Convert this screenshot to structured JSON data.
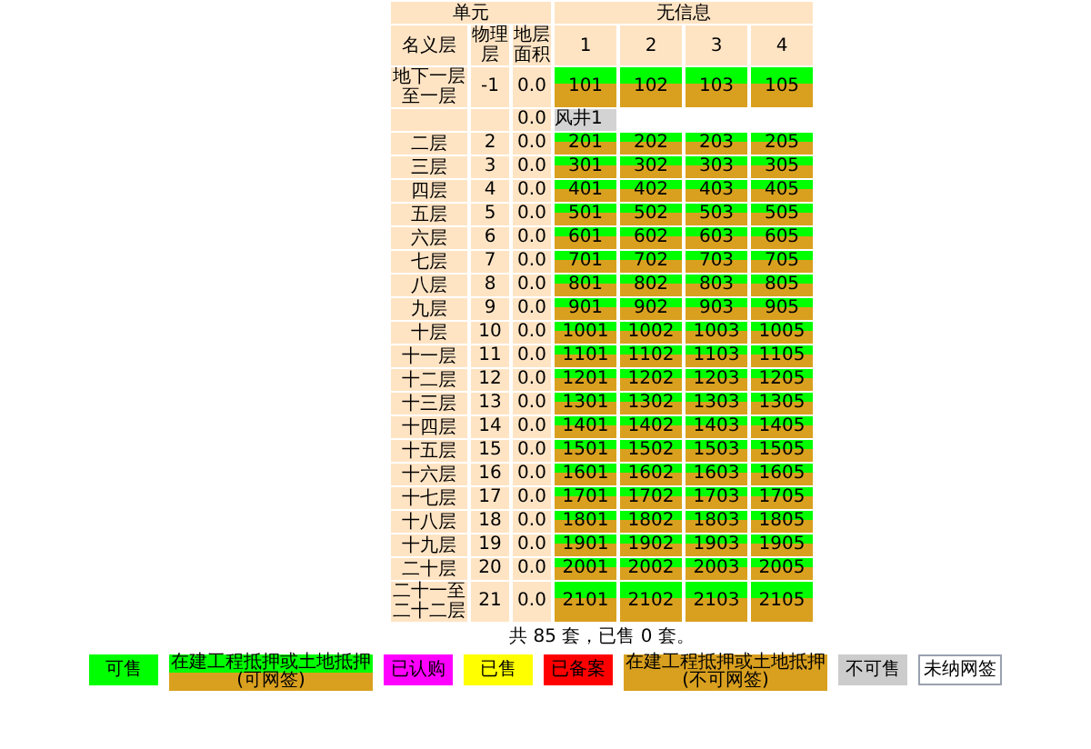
{
  "header": {
    "unit_label": "单元",
    "info": "无信息",
    "col_name": "名义层",
    "col_physical": "物理层",
    "col_area": "地层面积",
    "unit_numbers": [
      "1",
      "2",
      "3",
      "4"
    ]
  },
  "floors": [
    {
      "name": "地下一层至一层",
      "physical": "-1",
      "area": "0.0",
      "units": [
        {
          "label": "101",
          "kind": "mortgage_signable"
        },
        {
          "label": "102",
          "kind": "mortgage_signable"
        },
        {
          "label": "103",
          "kind": "mortgage_signable"
        },
        {
          "label": "105",
          "kind": "mortgage_signable"
        }
      ]
    },
    {
      "area": "0.0",
      "units": [
        {
          "label": "风井1",
          "kind": "shaft"
        }
      ]
    },
    {
      "name": "二层",
      "physical": "2",
      "area": "0.0",
      "units": [
        {
          "label": "201",
          "kind": "mortgage_signable"
        },
        {
          "label": "202",
          "kind": "mortgage_signable"
        },
        {
          "label": "203",
          "kind": "mortgage_signable"
        },
        {
          "label": "205",
          "kind": "mortgage_signable"
        }
      ]
    },
    {
      "name": "三层",
      "physical": "3",
      "area": "0.0",
      "units": [
        {
          "label": "301",
          "kind": "mortgage_signable"
        },
        {
          "label": "302",
          "kind": "mortgage_signable"
        },
        {
          "label": "303",
          "kind": "mortgage_signable"
        },
        {
          "label": "305",
          "kind": "mortgage_signable"
        }
      ]
    },
    {
      "name": "四层",
      "physical": "4",
      "area": "0.0",
      "units": [
        {
          "label": "401",
          "kind": "mortgage_signable"
        },
        {
          "label": "402",
          "kind": "mortgage_signable"
        },
        {
          "label": "403",
          "kind": "mortgage_signable"
        },
        {
          "label": "405",
          "kind": "mortgage_signable"
        }
      ]
    },
    {
      "name": "五层",
      "physical": "5",
      "area": "0.0",
      "units": [
        {
          "label": "501",
          "kind": "mortgage_signable"
        },
        {
          "label": "502",
          "kind": "mortgage_signable"
        },
        {
          "label": "503",
          "kind": "mortgage_signable"
        },
        {
          "label": "505",
          "kind": "mortgage_signable"
        }
      ]
    },
    {
      "name": "六层",
      "physical": "6",
      "area": "0.0",
      "units": [
        {
          "label": "601",
          "kind": "mortgage_signable"
        },
        {
          "label": "602",
          "kind": "mortgage_signable"
        },
        {
          "label": "603",
          "kind": "mortgage_signable"
        },
        {
          "label": "605",
          "kind": "mortgage_signable"
        }
      ]
    },
    {
      "name": "七层",
      "physical": "7",
      "area": "0.0",
      "units": [
        {
          "label": "701",
          "kind": "mortgage_signable"
        },
        {
          "label": "702",
          "kind": "mortgage_signable"
        },
        {
          "label": "703",
          "kind": "mortgage_signable"
        },
        {
          "label": "705",
          "kind": "mortgage_signable"
        }
      ]
    },
    {
      "name": "八层",
      "physical": "8",
      "area": "0.0",
      "units": [
        {
          "label": "801",
          "kind": "mortgage_signable"
        },
        {
          "label": "802",
          "kind": "mortgage_signable"
        },
        {
          "label": "803",
          "kind": "mortgage_signable"
        },
        {
          "label": "805",
          "kind": "mortgage_signable"
        }
      ]
    },
    {
      "name": "九层",
      "physical": "9",
      "area": "0.0",
      "units": [
        {
          "label": "901",
          "kind": "mortgage_signable"
        },
        {
          "label": "902",
          "kind": "mortgage_signable"
        },
        {
          "label": "903",
          "kind": "mortgage_signable"
        },
        {
          "label": "905",
          "kind": "mortgage_signable"
        }
      ]
    },
    {
      "name": "十层",
      "physical": "10",
      "area": "0.0",
      "units": [
        {
          "label": "1001",
          "kind": "mortgage_signable"
        },
        {
          "label": "1002",
          "kind": "mortgage_signable"
        },
        {
          "label": "1003",
          "kind": "mortgage_signable"
        },
        {
          "label": "1005",
          "kind": "mortgage_signable"
        }
      ]
    },
    {
      "name": "十一层",
      "physical": "11",
      "area": "0.0",
      "units": [
        {
          "label": "1101",
          "kind": "mortgage_signable"
        },
        {
          "label": "1102",
          "kind": "mortgage_signable"
        },
        {
          "label": "1103",
          "kind": "mortgage_signable"
        },
        {
          "label": "1105",
          "kind": "mortgage_signable"
        }
      ]
    },
    {
      "name": "十二层",
      "physical": "12",
      "area": "0.0",
      "units": [
        {
          "label": "1201",
          "kind": "mortgage_signable"
        },
        {
          "label": "1202",
          "kind": "mortgage_signable"
        },
        {
          "label": "1203",
          "kind": "mortgage_signable"
        },
        {
          "label": "1205",
          "kind": "mortgage_signable"
        }
      ]
    },
    {
      "name": "十三层",
      "physical": "13",
      "area": "0.0",
      "units": [
        {
          "label": "1301",
          "kind": "mortgage_signable"
        },
        {
          "label": "1302",
          "kind": "mortgage_signable"
        },
        {
          "label": "1303",
          "kind": "mortgage_signable"
        },
        {
          "label": "1305",
          "kind": "mortgage_signable"
        }
      ]
    },
    {
      "name": "十四层",
      "physical": "14",
      "area": "0.0",
      "units": [
        {
          "label": "1401",
          "kind": "mortgage_signable"
        },
        {
          "label": "1402",
          "kind": "mortgage_signable"
        },
        {
          "label": "1403",
          "kind": "mortgage_signable"
        },
        {
          "label": "1405",
          "kind": "mortgage_signable"
        }
      ]
    },
    {
      "name": "十五层",
      "physical": "15",
      "area": "0.0",
      "units": [
        {
          "label": "1501",
          "kind": "mortgage_signable"
        },
        {
          "label": "1502",
          "kind": "mortgage_signable"
        },
        {
          "label": "1503",
          "kind": "mortgage_signable"
        },
        {
          "label": "1505",
          "kind": "mortgage_signable"
        }
      ]
    },
    {
      "name": "十六层",
      "physical": "16",
      "area": "0.0",
      "units": [
        {
          "label": "1601",
          "kind": "mortgage_signable"
        },
        {
          "label": "1602",
          "kind": "mortgage_signable"
        },
        {
          "label": "1603",
          "kind": "mortgage_signable"
        },
        {
          "label": "1605",
          "kind": "mortgage_signable"
        }
      ]
    },
    {
      "name": "十七层",
      "physical": "17",
      "area": "0.0",
      "units": [
        {
          "label": "1701",
          "kind": "mortgage_signable"
        },
        {
          "label": "1702",
          "kind": "mortgage_signable"
        },
        {
          "label": "1703",
          "kind": "mortgage_signable"
        },
        {
          "label": "1705",
          "kind": "mortgage_signable"
        }
      ]
    },
    {
      "name": "十八层",
      "physical": "18",
      "area": "0.0",
      "units": [
        {
          "label": "1801",
          "kind": "mortgage_signable"
        },
        {
          "label": "1802",
          "kind": "mortgage_signable"
        },
        {
          "label": "1803",
          "kind": "mortgage_signable"
        },
        {
          "label": "1805",
          "kind": "mortgage_signable"
        }
      ]
    },
    {
      "name": "十九层",
      "physical": "19",
      "area": "0.0",
      "units": [
        {
          "label": "1901",
          "kind": "mortgage_signable"
        },
        {
          "label": "1902",
          "kind": "mortgage_signable"
        },
        {
          "label": "1903",
          "kind": "mortgage_signable"
        },
        {
          "label": "1905",
          "kind": "mortgage_signable"
        }
      ]
    },
    {
      "name": "二十层",
      "physical": "20",
      "area": "0.0",
      "units": [
        {
          "label": "2001",
          "kind": "mortgage_signable"
        },
        {
          "label": "2002",
          "kind": "mortgage_signable"
        },
        {
          "label": "2003",
          "kind": "mortgage_signable"
        },
        {
          "label": "2005",
          "kind": "mortgage_signable"
        }
      ]
    },
    {
      "name": "二十一至二十二层",
      "physical": "21",
      "area": "0.0",
      "units": [
        {
          "label": "2101",
          "kind": "mortgage_signable"
        },
        {
          "label": "2102",
          "kind": "mortgage_signable"
        },
        {
          "label": "2103",
          "kind": "mortgage_signable"
        },
        {
          "label": "2105",
          "kind": "mortgage_signable"
        }
      ]
    }
  ],
  "summary": "共 85 套，已售 0 套。",
  "legend": [
    {
      "label": "可售",
      "kind": "available"
    },
    {
      "label": "在建工程抵押或土地抵押",
      "sub": "(可网签)",
      "kind": "mortgage_signable"
    },
    {
      "label": "已认购",
      "kind": "subscribed"
    },
    {
      "label": "已售",
      "kind": "sold"
    },
    {
      "label": "已备案",
      "kind": "filed"
    },
    {
      "label": "在建工程抵押或土地抵押",
      "sub": "(不可网签)",
      "kind": "mortgage_unsignable"
    },
    {
      "label": "不可售",
      "kind": "unsaleable"
    },
    {
      "label": "未纳网签",
      "kind": "other"
    }
  ]
}
